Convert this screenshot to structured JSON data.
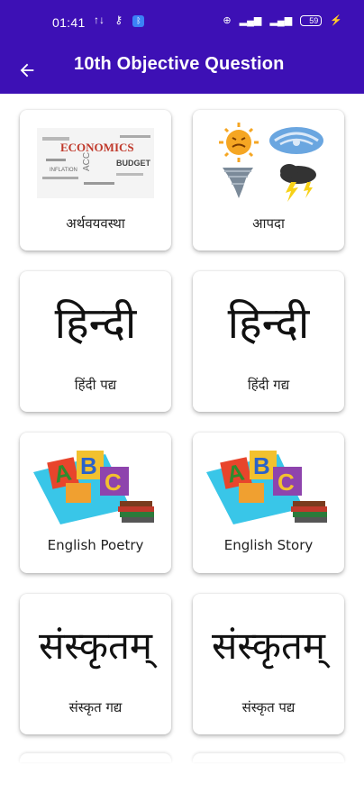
{
  "status_bar": {
    "time": "01:41",
    "left_icons": [
      "data-transfer-icon",
      "key-icon",
      "bluetooth-icon"
    ],
    "right_icons": [
      "hd-icon",
      "4g-signal-icon",
      "4g-signal-icon"
    ],
    "battery": "59"
  },
  "app_bar": {
    "title": "10th Objective Question"
  },
  "cards": [
    {
      "label": "अर्थवयवस्था",
      "image": "economics-word-cloud",
      "image_text": [
        "ECONOMICS",
        "BUDGET",
        "INFLATION"
      ]
    },
    {
      "label": "आपदा",
      "image": "weather-disaster-icons"
    },
    {
      "label": "हिंदी पद्य",
      "image": "hindi-word",
      "image_text": "हिन्दी"
    },
    {
      "label": "हिंदी गद्य",
      "image": "hindi-word",
      "image_text": "हिन्दी"
    },
    {
      "label": "English Poetry",
      "image": "abc-blocks-books"
    },
    {
      "label": "English Story",
      "image": "abc-blocks-books"
    },
    {
      "label": "संस्कृत गद्य",
      "image": "sanskrit-word",
      "image_text": "संस्कृतम्"
    },
    {
      "label": "संस्कृत पद्य",
      "image": "sanskrit-word",
      "image_text": "संस्कृतम्"
    }
  ],
  "colors": {
    "primary": "#3d10b5",
    "card_bg": "#ffffff",
    "text": "#222222"
  }
}
